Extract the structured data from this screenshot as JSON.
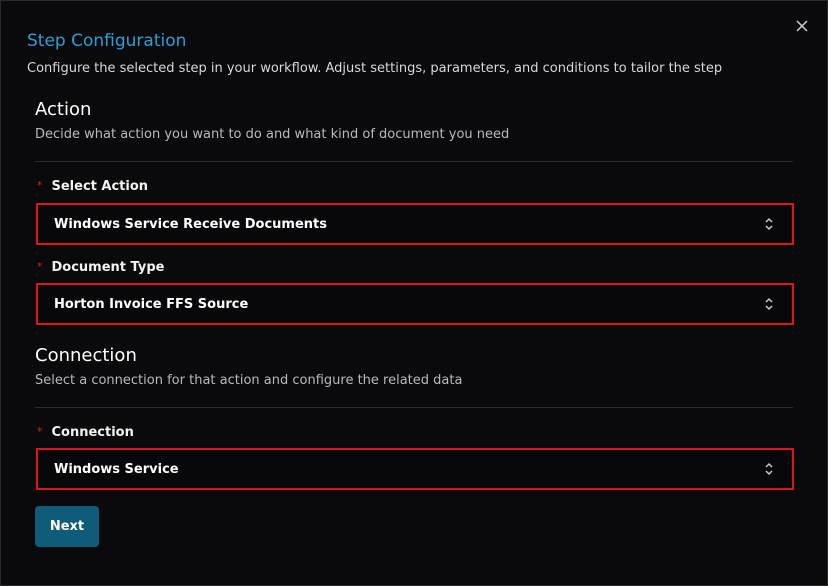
{
  "dialog": {
    "title": "Step Configuration",
    "subtitle": "Configure the selected step in your workflow. Adjust settings, parameters, and conditions to tailor the step",
    "close_icon": "close-icon"
  },
  "action_section": {
    "title": "Action",
    "description": "Decide what action you want to do and what kind of document you need",
    "fields": [
      {
        "label": "Select Action",
        "required_mark": "*",
        "value": "Windows Service Receive Documents"
      },
      {
        "label": "Document Type",
        "required_mark": "*",
        "value": "Horton Invoice FFS Source"
      }
    ]
  },
  "connection_section": {
    "title": "Connection",
    "description": "Select a connection for that action and configure the related data",
    "fields": [
      {
        "label": "Connection",
        "required_mark": "*",
        "value": "Windows Service"
      }
    ]
  },
  "footer": {
    "next_label": "Next"
  },
  "colors": {
    "accent_title": "#2b9fd6",
    "highlight_border": "#e0141b",
    "button_bg": "#0f5c78",
    "required_mark": "#c0282d"
  }
}
